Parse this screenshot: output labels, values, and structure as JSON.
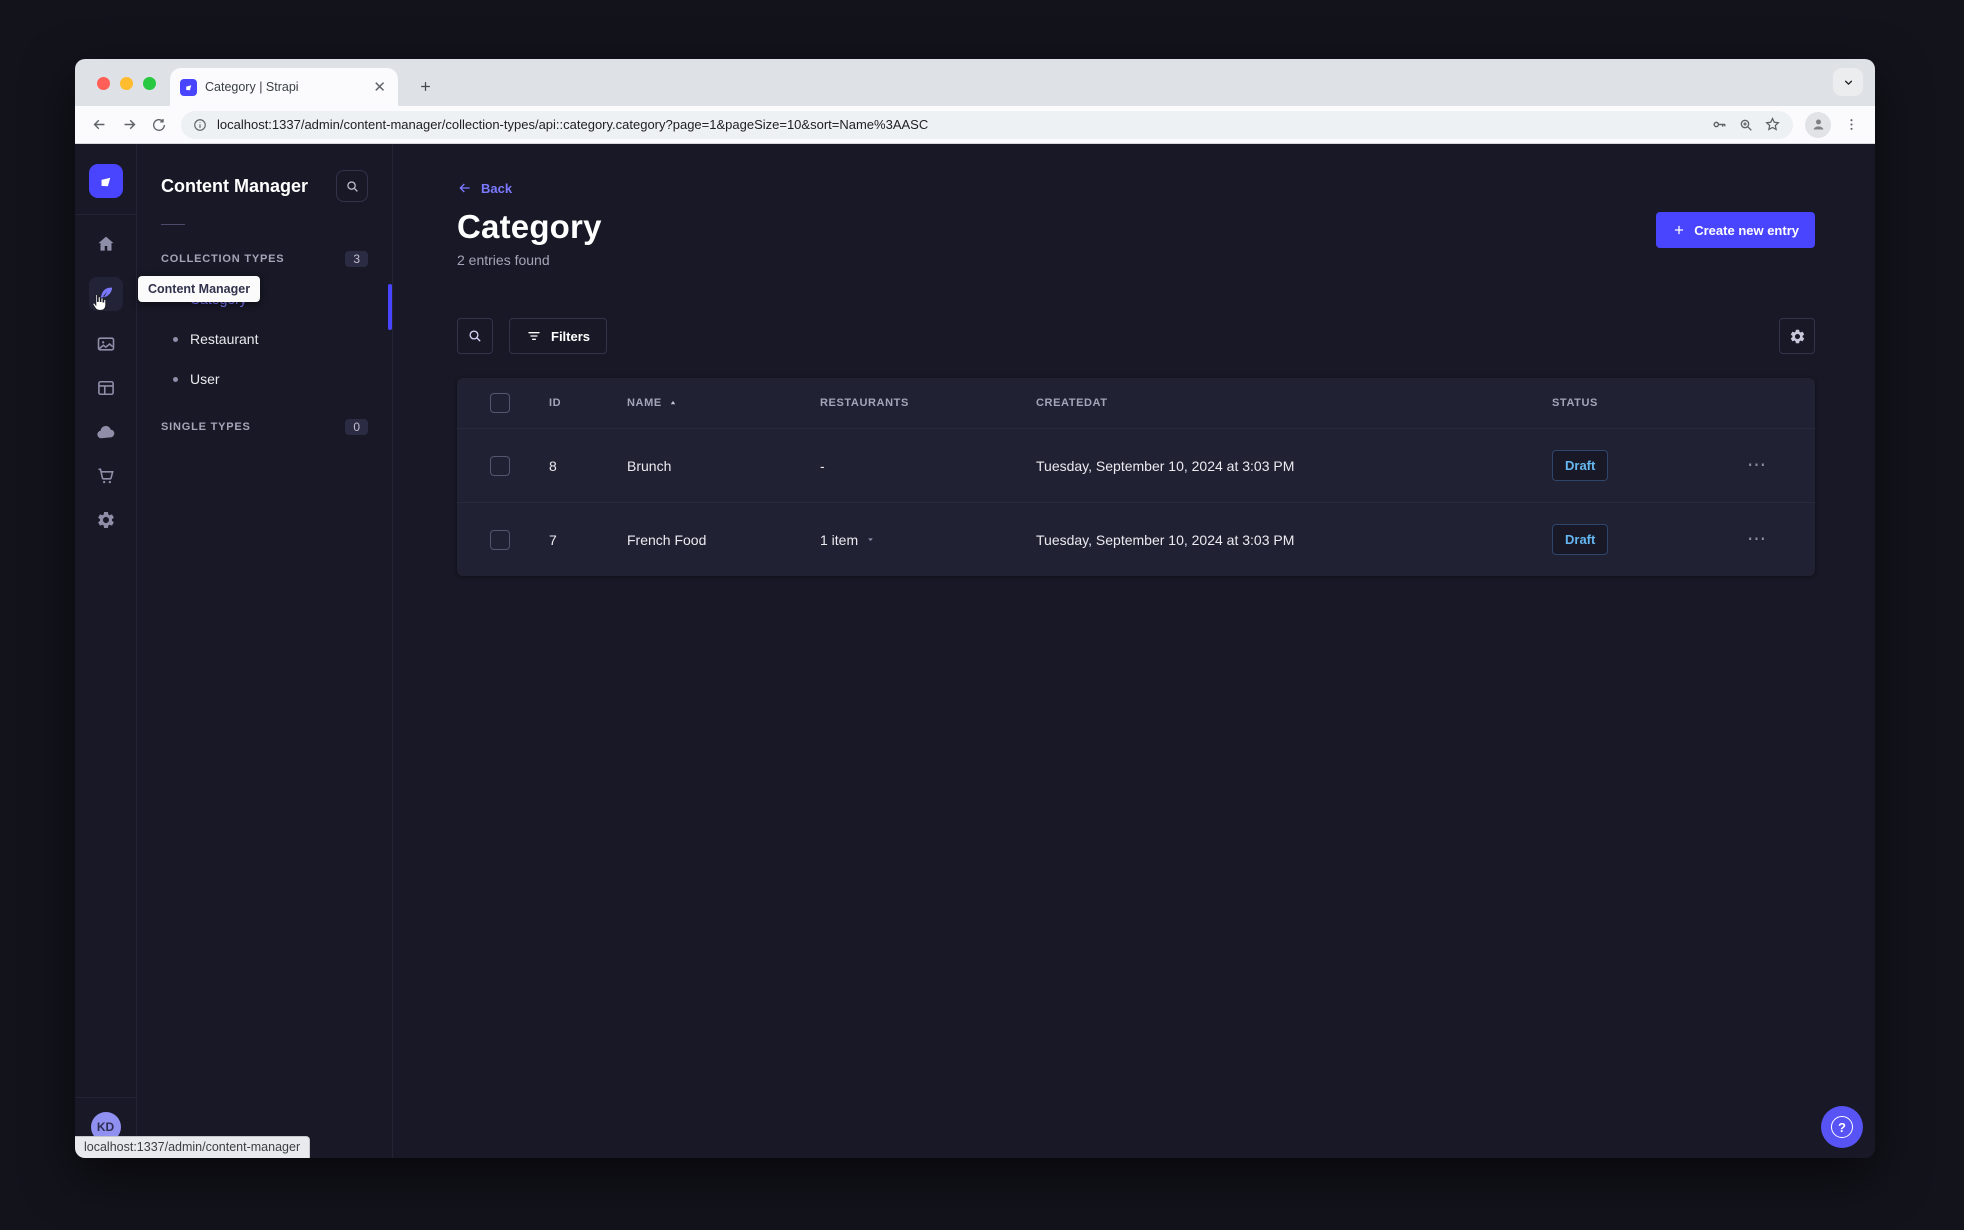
{
  "browser": {
    "tab_title": "Category | Strapi",
    "url": "localhost:1337/admin/content-manager/collection-types/api::category.category?page=1&pageSize=10&sort=Name%3AASC",
    "status_tooltip": "localhost:1337/admin/content-manager"
  },
  "sidebar": {
    "tooltip": "Content Manager",
    "avatar_initials": "KD",
    "icons": [
      "home",
      "content-manager",
      "media-library",
      "content-type-builder",
      "cloud",
      "marketplace",
      "settings"
    ]
  },
  "subnav": {
    "title": "Content Manager",
    "collection": {
      "label": "COLLECTION TYPES",
      "count": "3"
    },
    "single": {
      "label": "SINGLE TYPES",
      "count": "0"
    },
    "items": [
      {
        "label": "Category"
      },
      {
        "label": "Restaurant"
      },
      {
        "label": "User"
      }
    ]
  },
  "main": {
    "back_label": "Back",
    "title": "Category",
    "subtitle": "2 entries found",
    "create_label": "Create new entry",
    "filters_label": "Filters",
    "table": {
      "headers": [
        "ID",
        "NAME",
        "RESTAURANTS",
        "CREATEDAT",
        "STATUS"
      ],
      "rows": [
        {
          "id": "8",
          "name": "Brunch",
          "restaurants": "-",
          "created": "Tuesday, September 10, 2024 at 3:03 PM",
          "status": "Draft"
        },
        {
          "id": "7",
          "name": "French Food",
          "restaurants": "1 item",
          "created": "Tuesday, September 10, 2024 at 3:03 PM",
          "status": "Draft"
        }
      ]
    }
  },
  "colors": {
    "primary": "#4945ff",
    "primary_light": "#7b79ff",
    "draft_text": "#66b7f1",
    "app_bg": "#181826",
    "card_bg": "#212134",
    "traffic_red": "#ff5f57",
    "traffic_yellow": "#febc2e",
    "traffic_green": "#28c840"
  }
}
